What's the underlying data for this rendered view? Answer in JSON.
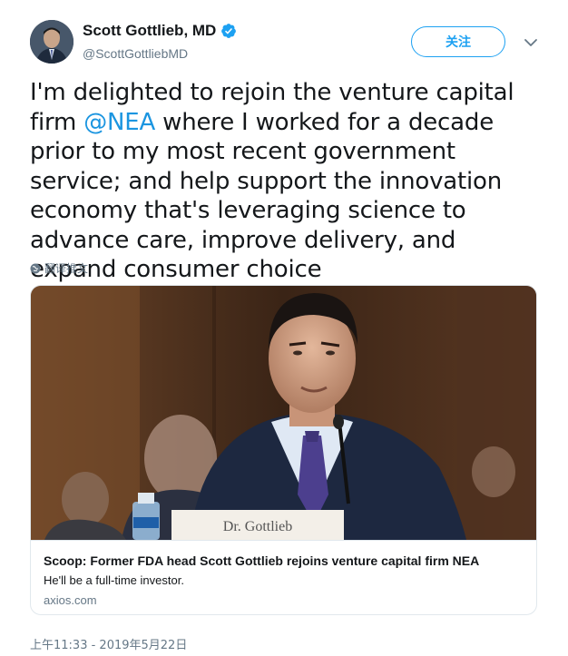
{
  "author": {
    "name": "Scott Gottlieb, MD",
    "handle": "@ScottGottliebMD",
    "verified": true
  },
  "follow_label": "关注",
  "tweet": {
    "text_before": "I'm delighted to rejoin the venture capital firm ",
    "mention": "@NEA",
    "text_after": " where I worked for a decade prior to my most recent government service; and help support the innovation economy that's leveraging science to advance care, improve delivery, and expand consumer choice"
  },
  "translate_label": "翻译推文",
  "card": {
    "title": "Scoop: Former FDA head Scott Gottlieb rejoins venture capital firm NEA",
    "description": "He'll be a full-time investor.",
    "domain": "axios.com"
  },
  "timestamp": "上午11:33 - 2019年5月22日",
  "colors": {
    "accent": "#1da1f2",
    "mention": "#1b95e0",
    "secondary_text": "#657786"
  },
  "icons": [
    "verified-badge-icon",
    "chevron-down-icon",
    "globe-icon"
  ]
}
